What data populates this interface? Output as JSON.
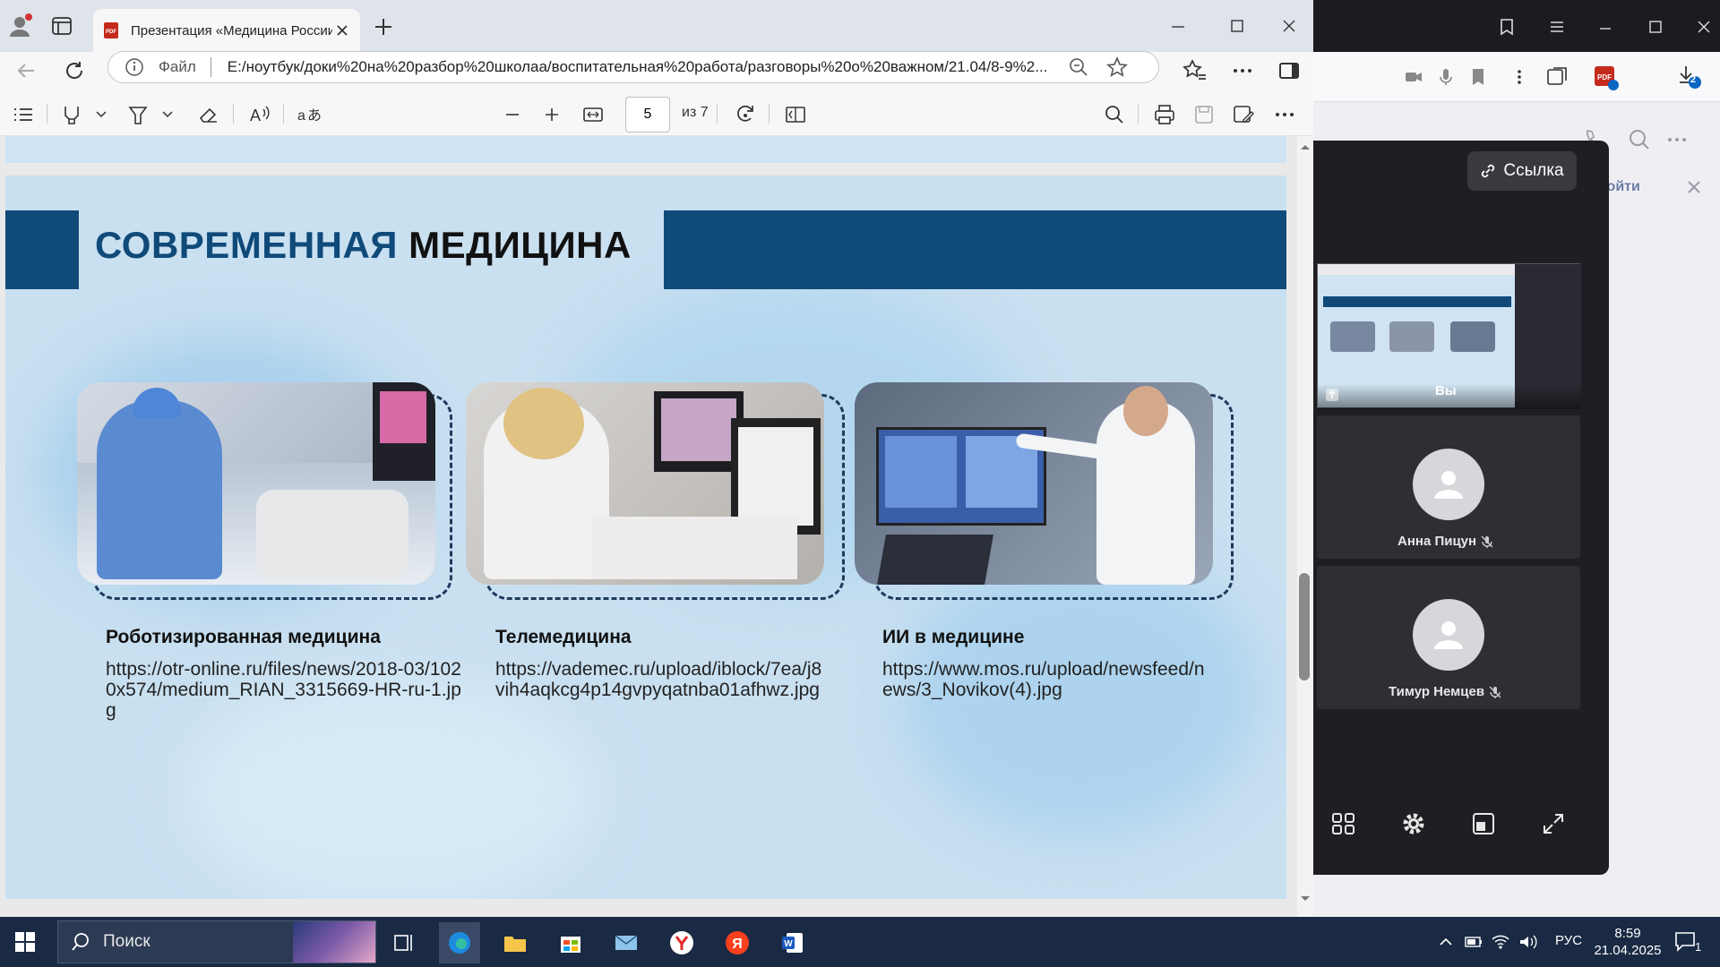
{
  "browser": {
    "tab_title": "Презентация «Медицина России»",
    "url_file_label": "Файл",
    "url": "E:/ноутбук/доки%20на%20разбор%20школаа/воспитательная%20работа/разговоры%20о%20важном/21.04/8-9%2..."
  },
  "pdf_toolbar": {
    "page_current": "5",
    "page_total": "из 7"
  },
  "slide": {
    "title_part1": "СОВРЕМЕННАЯ",
    "title_part2": "МЕДИЦИНА",
    "items": [
      {
        "caption": "Роботизированная медицина",
        "link": "https://otr-online.ru/files/news/2018-03/1020x574/medium_RIAN_3315669-HR-ru-1.jpg"
      },
      {
        "caption": "Телемедицина",
        "link": "https://vademec.ru/upload/iblock/7ea/j8vih4aqkcg4p14gvpyqatnba01afhwz.jpg"
      },
      {
        "caption": "ИИ в медицине",
        "link": "https://www.mos.ru/upload/newsfeed/news/3_Novikov(4).jpg"
      }
    ]
  },
  "conference": {
    "link_button": "Ссылка",
    "self_label": "Вы",
    "participants": [
      {
        "name": "Анна Пицун"
      },
      {
        "name": "Тимур Немцев"
      }
    ]
  },
  "background_app": {
    "login_text": "Войти"
  },
  "taskbar": {
    "search_placeholder": "Поиск",
    "language": "РУС",
    "time": "8:59",
    "date": "21.04.2025",
    "notifications_count": "1",
    "downloads_badge": "2"
  }
}
